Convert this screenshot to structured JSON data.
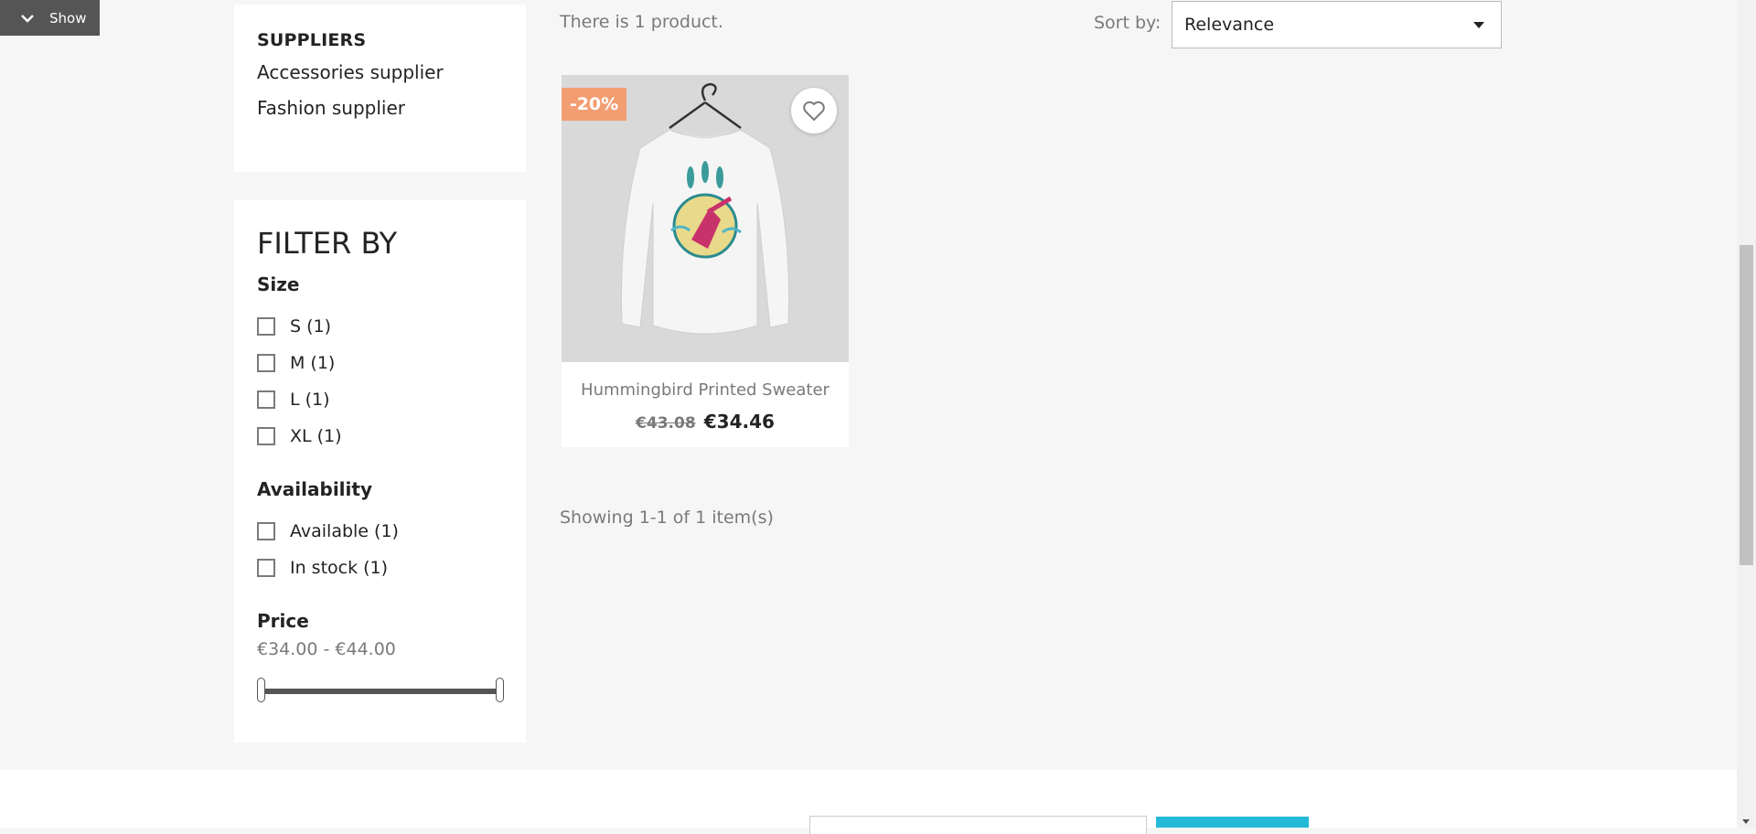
{
  "toggle": {
    "label": "Show",
    "icon": "chevron-down-icon"
  },
  "suppliers": {
    "heading": "SUPPLIERS",
    "items": [
      "Accessories supplier",
      "Fashion supplier"
    ]
  },
  "filters": {
    "title": "FILTER BY",
    "size": {
      "title": "Size",
      "options": [
        "S (1)",
        "M (1)",
        "L (1)",
        "XL (1)"
      ]
    },
    "availability": {
      "title": "Availability",
      "options": [
        "Available (1)",
        "In stock (1)"
      ]
    },
    "price": {
      "title": "Price",
      "range": "€34.00 - €44.00"
    }
  },
  "listing": {
    "count_text": "There is 1 product.",
    "sort_label": "Sort by:",
    "sort_value": "Relevance",
    "showing_text": "Showing 1-1 of 1 item(s)"
  },
  "product": {
    "discount_badge": "-20%",
    "name": "Hummingbird Printed Sweater",
    "old_price": "€43.08",
    "price": "€34.46",
    "wishlist_icon": "heart-icon"
  },
  "colors": {
    "badge": "#f39d72",
    "accent": "#24b9d7",
    "dark": "#232323",
    "muted": "#7a7a7a"
  }
}
